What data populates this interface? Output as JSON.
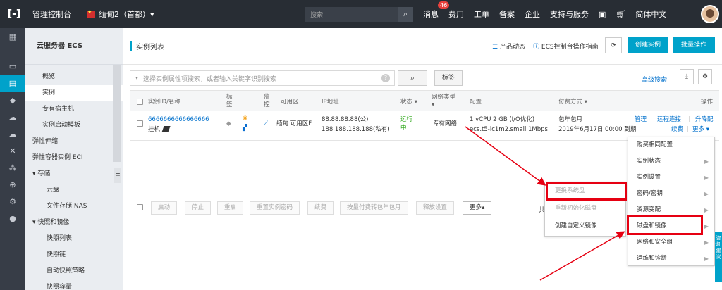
{
  "topbar": {
    "logo": "[-]",
    "console": "管理控制台",
    "region": "缅甸2（首都）▾",
    "search_placeholder": "搜索",
    "nav": [
      "消息",
      "费用",
      "工单",
      "备案",
      "企业",
      "支持与服务",
      "简体中文"
    ],
    "message_count": "46"
  },
  "sidebar": {
    "title": "云服务器 ECS",
    "items": [
      {
        "label": "概览",
        "type": "item"
      },
      {
        "label": "实例",
        "type": "item",
        "active": true
      },
      {
        "label": "专有宿主机",
        "type": "item"
      },
      {
        "label": "实例启动模板",
        "type": "item"
      },
      {
        "label": "弹性伸缩",
        "type": "sec"
      },
      {
        "label": "弹性容器实例 ECI",
        "type": "sec"
      },
      {
        "label": "▾  存储",
        "type": "sec"
      },
      {
        "label": "云盘",
        "type": "sub"
      },
      {
        "label": "文件存储 NAS",
        "type": "sub"
      },
      {
        "label": "▾  快照和镜像",
        "type": "sec"
      },
      {
        "label": "快照列表",
        "type": "sub"
      },
      {
        "label": "快照链",
        "type": "sub"
      },
      {
        "label": "自动快照策略",
        "type": "sub"
      },
      {
        "label": "快照容量",
        "type": "sub"
      }
    ]
  },
  "header": {
    "title": "实例列表",
    "product_news": "产品动态",
    "guide": "ECS控制台操作指南",
    "create": "创建实例",
    "batch": "批量操作"
  },
  "filter": {
    "placeholder": "选择实例属性项搜索，或者输入关键字识别搜索",
    "tag_btn": "标签",
    "advanced": "高级搜索"
  },
  "table": {
    "headers": {
      "id": "实例ID/名称",
      "tag": "标\n签",
      "monitor": "监\n控",
      "zone": "可用区",
      "ip": "IP地址",
      "status": "状态 ▾",
      "network": "网络类型\n▾",
      "config": "配置",
      "billing": "付费方式 ▾",
      "ops": "操作"
    },
    "row": {
      "id": "6666666666666666",
      "name": "挂机",
      "zone": "缅甸 可用区F",
      "ip_public": "88.88.88.88(公)",
      "ip_private": "188.188.188.188(私有)",
      "status": "运行\n中",
      "network": "专有网络",
      "config_1": "1 vCPU 2 GB (I/O优化)",
      "config_2": "ecs.t5-lc1m2.small  1Mbps",
      "billing_1": "包年包月",
      "billing_2": "2019年6月17日 00:00 到期",
      "op_manage": "管理",
      "op_remote": "远程连接",
      "op_upgrade": "升降配",
      "op_renew": "续费",
      "op_more": "更多 ▾"
    }
  },
  "footer": {
    "buttons": [
      "启动",
      "停止",
      "重启",
      "重置实例密码",
      "续费",
      "按量付费转包年包月",
      "释放设置",
      "更多▴"
    ],
    "total": "共有"
  },
  "submenu": [
    "更换系统盘",
    "重新初始化磁盘",
    "创建自定义镜像"
  ],
  "more_menu": [
    "购买相同配置",
    "实例状态",
    "实例设置",
    "密码/密钥",
    "资源变配",
    "磁盘和镜像",
    "网络和安全组",
    "运维和诊断"
  ],
  "float_text": "咨询·建议",
  "colors": {
    "accent": "#00a2ca",
    "highlight": "#e60012",
    "topbar": "#282d34"
  }
}
